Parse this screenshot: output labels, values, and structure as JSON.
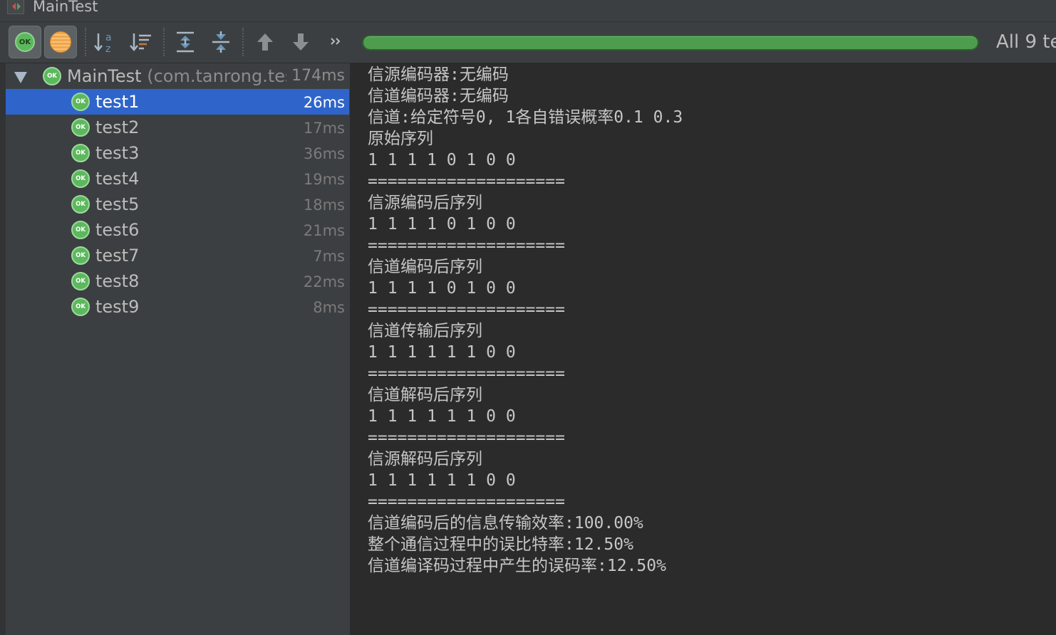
{
  "window": {
    "title": "MainTest"
  },
  "toolbar": {
    "show_passed_icon": "ok-icon",
    "show_passed_label": "OK",
    "show_ignored_icon": "ignored-icon",
    "progress_percent": 100,
    "progress_color": "#4e9d4e",
    "summary": "All 9 te"
  },
  "tree": {
    "root": {
      "status": "OK",
      "name": "MainTest",
      "package": "(com.tanrong.tes",
      "time": "174ms"
    },
    "tests": [
      {
        "status": "OK",
        "name": "test1",
        "time": "26ms",
        "selected": true
      },
      {
        "status": "OK",
        "name": "test2",
        "time": "17ms",
        "selected": false
      },
      {
        "status": "OK",
        "name": "test3",
        "time": "36ms",
        "selected": false
      },
      {
        "status": "OK",
        "name": "test4",
        "time": "19ms",
        "selected": false
      },
      {
        "status": "OK",
        "name": "test5",
        "time": "18ms",
        "selected": false
      },
      {
        "status": "OK",
        "name": "test6",
        "time": "21ms",
        "selected": false
      },
      {
        "status": "OK",
        "name": "test7",
        "time": "7ms",
        "selected": false
      },
      {
        "status": "OK",
        "name": "test8",
        "time": "22ms",
        "selected": false
      },
      {
        "status": "OK",
        "name": "test9",
        "time": "8ms",
        "selected": false
      }
    ]
  },
  "console": {
    "lines": [
      "信源编码器:无编码",
      "信道编码器:无编码",
      "信道:给定符号0, 1各自错误概率0.1 0.3",
      "原始序列",
      "1 1 1 1 0 1 0 0",
      "====================",
      "信源编码后序列",
      "1 1 1 1 0 1 0 0",
      "====================",
      "信道编码后序列",
      "1 1 1 1 0 1 0 0",
      "====================",
      "信道传输后序列",
      "1 1 1 1 1 1 0 0",
      "====================",
      "信道解码后序列",
      "1 1 1 1 1 1 0 0",
      "====================",
      "信源解码后序列",
      "1 1 1 1 1 1 0 0",
      "====================",
      "信道编码后的信息传输效率:100.00%",
      "整个通信过程中的误比特率:12.50%",
      "信道编译码过程中产生的误码率:12.50%"
    ]
  }
}
